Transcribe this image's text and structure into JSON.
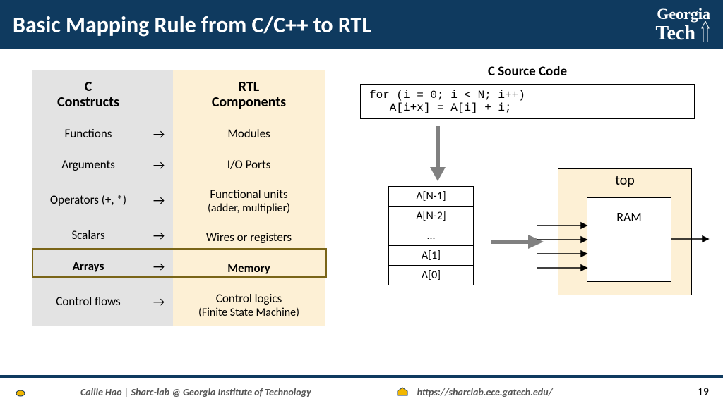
{
  "header": {
    "title": "Basic Mapping Rule from C/C++ to RTL",
    "logo_line1": "Georgia",
    "logo_line2": "Tech"
  },
  "table": {
    "c_header": "C\nConstructs",
    "rtl_header": "RTL\nComponents",
    "rows": [
      {
        "c": "Functions",
        "rtl": "Modules",
        "bold": false
      },
      {
        "c": "Arguments",
        "rtl": "I/O Ports",
        "bold": false
      },
      {
        "c": "Operators (+, *)",
        "rtl": "Functional units",
        "rtl_sub": "(adder, multiplier)",
        "bold": false
      },
      {
        "c": "Scalars",
        "rtl": "Wires or registers",
        "bold": false
      },
      {
        "c": "Arrays",
        "rtl": "Memory",
        "bold": true
      },
      {
        "c": "Control flows",
        "rtl": "Control logics",
        "rtl_sub": "(Finite State Machine)",
        "bold": false
      }
    ],
    "arrow": "→"
  },
  "source": {
    "title": "C Source Code",
    "code": "for (i = 0; i < N; i++)\n   A[i+x] = A[i] + i;"
  },
  "array_stack": [
    "A[N-1]",
    "A[N-2]",
    "...",
    "A[1]",
    "A[0]"
  ],
  "module": {
    "label": "top",
    "ram": "RAM"
  },
  "footer": {
    "author": "Callie Hao | Sharc-lab @ Georgia Institute of Technology",
    "url": "https://sharclab.ece.gatech.edu/",
    "page": "19"
  }
}
